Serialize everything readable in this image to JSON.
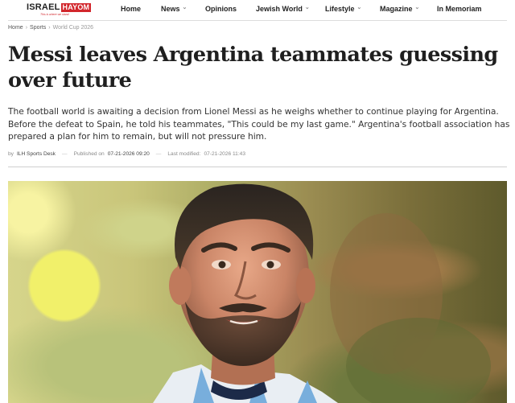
{
  "brand": {
    "name_part1": "ISRAEL",
    "name_part2": "HAYOM",
    "tagline": "This is where we stand",
    "accent_color": "#d2262c"
  },
  "nav": {
    "items": [
      {
        "label": "Home",
        "has_dropdown": false
      },
      {
        "label": "News",
        "has_dropdown": true
      },
      {
        "label": "Opinions",
        "has_dropdown": false
      },
      {
        "label": "Jewish World",
        "has_dropdown": true
      },
      {
        "label": "Lifestyle",
        "has_dropdown": true
      },
      {
        "label": "Magazine",
        "has_dropdown": true
      },
      {
        "label": "In Memoriam",
        "has_dropdown": false
      }
    ]
  },
  "breadcrumb": {
    "items": [
      "Home",
      "Sports",
      "World Cup 2026"
    ]
  },
  "article": {
    "headline": "Messi leaves Argentina teammates guessing over future",
    "lede": "The football world is awaiting a decision from Lionel Messi as he weighs whether to continue playing for Argentina. Before the defeat to Spain, he told his teammates, \"This could be my last game.\" Argentina's football association has prepared a plan for him to remain, but will not pressure him.",
    "byline_prefix": "by",
    "author": "ILH Sports Desk",
    "published_label": "Published on",
    "published": "07-21-2026 09:20",
    "modified_label": "Last modified:",
    "modified": "07-21-2026 11:43"
  },
  "hero_image": {
    "subject": "lionel-messi-portrait"
  }
}
